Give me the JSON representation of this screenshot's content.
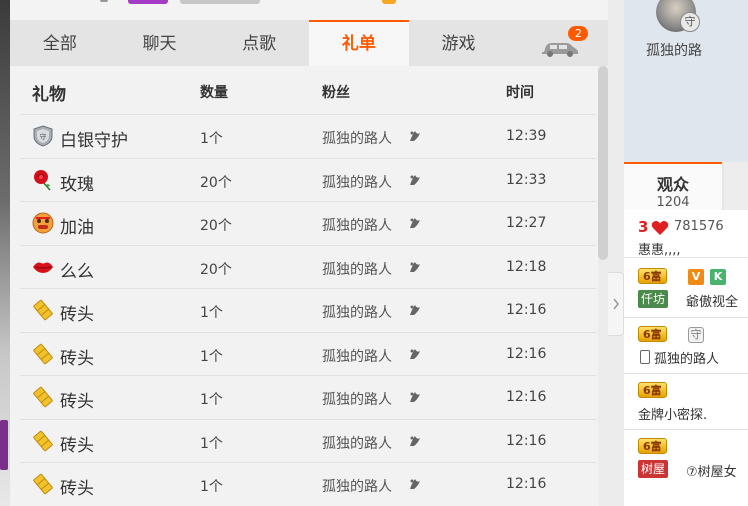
{
  "tabs": [
    {
      "label": "全部",
      "active": false
    },
    {
      "label": "聊天",
      "active": false
    },
    {
      "label": "点歌",
      "active": false
    },
    {
      "label": "礼单",
      "active": true
    },
    {
      "label": "游戏",
      "active": false
    }
  ],
  "car_tab": {
    "icon": "car-icon",
    "badge": "2"
  },
  "table": {
    "headers": {
      "gift": "礼物",
      "count": "数量",
      "fan": "粉丝",
      "time": "时间"
    },
    "rows": [
      {
        "icon": "silver-guard-icon",
        "gift": "白银守护",
        "count": "1个",
        "fan": "孤独的路人",
        "time": "12:39"
      },
      {
        "icon": "rose-icon",
        "gift": "玫瑰",
        "count": "20个",
        "fan": "孤独的路人",
        "time": "12:33"
      },
      {
        "icon": "cheer-face-icon",
        "gift": "加油",
        "count": "20个",
        "fan": "孤独的路人",
        "time": "12:27"
      },
      {
        "icon": "lips-icon",
        "gift": "么么",
        "count": "20个",
        "fan": "孤独的路人",
        "time": "12:18"
      },
      {
        "icon": "brick-icon",
        "gift": "砖头",
        "count": "1个",
        "fan": "孤独的路人",
        "time": "12:16"
      },
      {
        "icon": "brick-icon",
        "gift": "砖头",
        "count": "1个",
        "fan": "孤独的路人",
        "time": "12:16"
      },
      {
        "icon": "brick-icon",
        "gift": "砖头",
        "count": "1个",
        "fan": "孤独的路人",
        "time": "12:16"
      },
      {
        "icon": "brick-icon",
        "gift": "砖头",
        "count": "1个",
        "fan": "孤独的路人",
        "time": "12:16"
      },
      {
        "icon": "brick-icon",
        "gift": "砖头",
        "count": "1个",
        "fan": "孤独的路人",
        "time": "12:16"
      }
    ]
  },
  "profile": {
    "username": "孤独的路",
    "guard_badge": "守"
  },
  "audience": {
    "tab_label": "观众",
    "count": "1204",
    "items": [
      {
        "level": "3",
        "id": "781576",
        "name": "惠惠,,,,"
      },
      {
        "fortune": "6富",
        "v": "V",
        "k": "K",
        "tag": "仟坊",
        "name": "爺傲视全"
      },
      {
        "fortune": "6富",
        "guard": "守",
        "name": "孤独的路人"
      },
      {
        "fortune": "6富",
        "name": "金牌小密探."
      },
      {
        "fortune": "6富",
        "tag": "树屋",
        "name": "⑦树屋女"
      }
    ]
  },
  "colors": {
    "accent": "#ff5a00",
    "tab_bg": "#e4e4e4",
    "panel_bg": "#f2f2f2"
  }
}
